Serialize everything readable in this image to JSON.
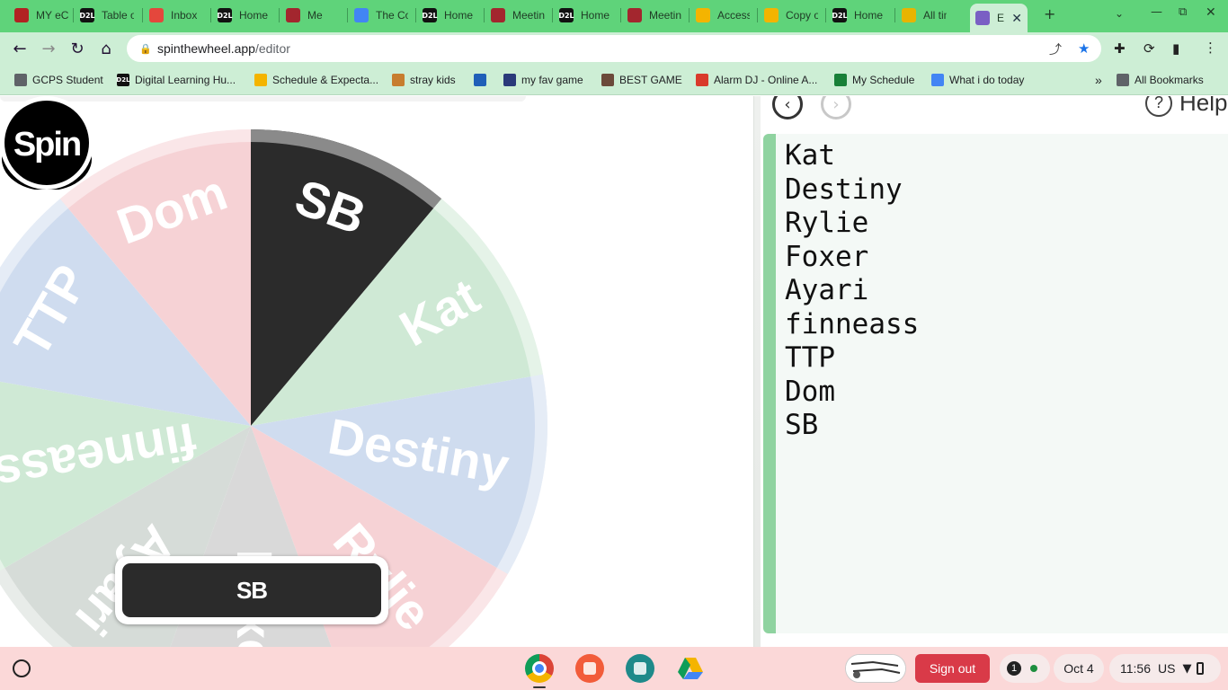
{
  "browser": {
    "tabs": [
      {
        "title": "MY eCl",
        "icon": "ecl-logo-icon",
        "color": "#b22222"
      },
      {
        "title": "Table o",
        "icon": "d2l-logo-icon",
        "color": "#111111"
      },
      {
        "title": "Inbox",
        "icon": "gmail-icon",
        "color": "#e4473c"
      },
      {
        "title": "Home",
        "icon": "d2l-logo-icon",
        "color": "#111111"
      },
      {
        "title": "Me",
        "icon": "meeting-icon",
        "color": "#a3262e"
      },
      {
        "title": "The Co",
        "icon": "google-g-icon",
        "color": "#4285f4"
      },
      {
        "title": "Home",
        "icon": "d2l-logo-icon",
        "color": "#111111"
      },
      {
        "title": "Meetin",
        "icon": "meeting-icon",
        "color": "#a3262e"
      },
      {
        "title": "Home",
        "icon": "d2l-logo-icon",
        "color": "#111111"
      },
      {
        "title": "Meetin",
        "icon": "meeting-icon",
        "color": "#a3262e"
      },
      {
        "title": "Access",
        "icon": "slides-icon",
        "color": "#f4b400"
      },
      {
        "title": "Copy o",
        "icon": "slides-icon",
        "color": "#f4b400"
      },
      {
        "title": "Home",
        "icon": "d2l-logo-icon",
        "color": "#111111"
      },
      {
        "title": "All tim",
        "icon": "chart-icon",
        "color": "#e8b400"
      },
      {
        "title": "Ed",
        "icon": "spinthewheel-icon",
        "color": "#7a5fc4",
        "active": true
      }
    ],
    "address": {
      "host": "spinthewheel.app",
      "path": "/editor"
    },
    "bookmarks": [
      {
        "label": "GCPS Student",
        "icon": "page-icon",
        "color": "#5f6368"
      },
      {
        "label": "Digital Learning Hu...",
        "icon": "d2l-logo-icon",
        "color": "#111111"
      },
      {
        "label": "Schedule & Expecta...",
        "icon": "slides-icon",
        "color": "#f4b400"
      },
      {
        "label": "stray kids",
        "icon": "stray-kids-icon",
        "color": "#c77d2e"
      },
      {
        "label": "",
        "icon": "edge-icon",
        "color": "#1f5fb8"
      },
      {
        "label": "my fav game",
        "icon": "game-icon",
        "color": "#2a3a7a"
      },
      {
        "label": "BEST GAME",
        "icon": "avatar-icon",
        "color": "#6b4a3a"
      },
      {
        "label": "Alarm DJ - Online A...",
        "icon": "alarm-icon",
        "color": "#d93a2b"
      },
      {
        "label": "My Schedule",
        "icon": "sheets-icon",
        "color": "#188038"
      },
      {
        "label": "What i do today",
        "icon": "docs-icon",
        "color": "#4285f4"
      }
    ],
    "all_bookmarks_label": "All Bookmarks"
  },
  "wheel": {
    "segments": [
      {
        "label": "SB",
        "color": "#2b2b2b",
        "text_color": "#ffffff"
      },
      {
        "label": "Kat",
        "color": "#cfe9d5",
        "text_color": "#ffffff"
      },
      {
        "label": "Destiny",
        "color": "#cfdcef",
        "text_color": "#ffffff"
      },
      {
        "label": "Rylie",
        "color": "#f6d2d5",
        "text_color": "#ffffff"
      },
      {
        "label": "Foxer",
        "color": "#d9d9d9",
        "text_color": "#ffffff"
      },
      {
        "label": "Ayari",
        "color": "#d6dcd8",
        "text_color": "#ffffff"
      },
      {
        "label": "finneass",
        "color": "#cfe9d5",
        "text_color": "#ffffff"
      },
      {
        "label": "TTP",
        "color": "#cfdcef",
        "text_color": "#ffffff"
      },
      {
        "label": "Dom",
        "color": "#f6d2d5",
        "text_color": "#ffffff"
      }
    ],
    "spin_label": "Spin",
    "result": "SB"
  },
  "editor": {
    "help_label": "Help",
    "entries": [
      "Kat",
      "Destiny",
      "Rylie",
      "Foxer",
      "Ayari",
      "finneass",
      "TTP",
      "Dom",
      "SB"
    ]
  },
  "shelf": {
    "apps": [
      {
        "name": "chrome-icon",
        "color": "#4285f4"
      },
      {
        "name": "canvas-paint-icon",
        "color": "#f25c3a"
      },
      {
        "name": "classroom-icon",
        "color": "#1e8a8a"
      },
      {
        "name": "drive-icon",
        "color": "#ffffff"
      }
    ],
    "sign_out": "Sign out",
    "notifications": "1",
    "date": "Oct 4",
    "time": "11:56",
    "locale": "US"
  }
}
